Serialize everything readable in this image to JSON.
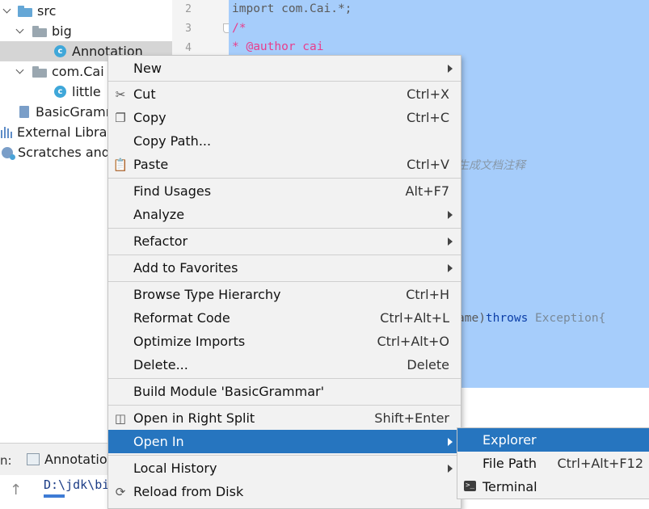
{
  "tree": {
    "items": [
      {
        "label": "src"
      },
      {
        "label": "big"
      },
      {
        "label": "Annotation"
      },
      {
        "label": "com.Cai"
      },
      {
        "label": "little"
      },
      {
        "label": "BasicGramm"
      },
      {
        "label": "External Librari"
      },
      {
        "label": "Scratches and C"
      }
    ],
    "class_icon_letter": "c"
  },
  "editor": {
    "line_numbers": [
      "2",
      "3",
      "4"
    ],
    "import_line": "import com.Cai.*;",
    "comment_open": "/*",
    "author_line": "* @author cai",
    "doc_comment_fragment": "生成文档注释",
    "sig_fragment": "ame)",
    "sig_throws": "throws",
    "sig_exception": " Exception{"
  },
  "bottom": {
    "label": "n:",
    "tab_label": "Annotation",
    "console_text": "D:\\jdk\\bi",
    "up_arrow": "↑"
  },
  "context_menu": {
    "items": [
      {
        "label": "New",
        "shortcut": "",
        "submenu": true
      },
      {
        "label": "Cut",
        "shortcut": "Ctrl+X"
      },
      {
        "label": "Copy",
        "shortcut": "Ctrl+C"
      },
      {
        "label": "Copy Path...",
        "shortcut": ""
      },
      {
        "label": "Paste",
        "shortcut": "Ctrl+V"
      },
      {
        "label": "Find Usages",
        "shortcut": "Alt+F7"
      },
      {
        "label": "Analyze",
        "shortcut": "",
        "submenu": true
      },
      {
        "label": "Refactor",
        "shortcut": "",
        "submenu": true
      },
      {
        "label": "Add to Favorites",
        "shortcut": "",
        "submenu": true
      },
      {
        "label": "Browse Type Hierarchy",
        "shortcut": "Ctrl+H"
      },
      {
        "label": "Reformat Code",
        "shortcut": "Ctrl+Alt+L"
      },
      {
        "label": "Optimize Imports",
        "shortcut": "Ctrl+Alt+O"
      },
      {
        "label": "Delete...",
        "shortcut": "Delete"
      },
      {
        "label": "Build Module 'BasicGrammar'",
        "shortcut": ""
      },
      {
        "label": "Open in Right Split",
        "shortcut": "Shift+Enter"
      },
      {
        "label": "Open In",
        "shortcut": "",
        "submenu": true,
        "highlighted": true
      },
      {
        "label": "Local History",
        "shortcut": "",
        "submenu": true
      },
      {
        "label": "Reload from Disk",
        "shortcut": ""
      }
    ],
    "highlight_color": "#2675bf"
  },
  "submenu": {
    "items": [
      {
        "label": "Explorer",
        "shortcut": "",
        "highlighted": true
      },
      {
        "label": "File Path",
        "shortcut": "Ctrl+Alt+F12"
      },
      {
        "label": "Terminal",
        "shortcut": ""
      }
    ]
  }
}
